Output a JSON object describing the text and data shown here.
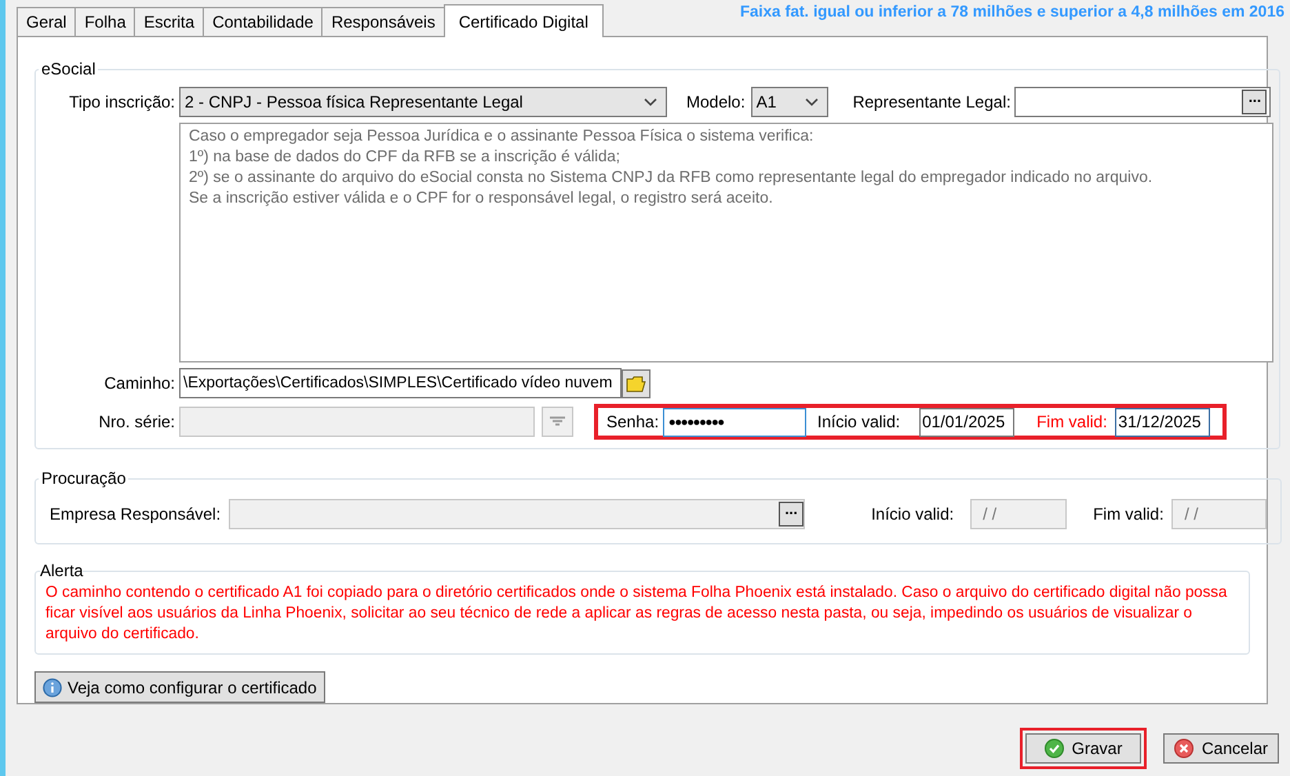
{
  "tabs": [
    {
      "label": "Geral",
      "selected": false
    },
    {
      "label": "Folha",
      "selected": false
    },
    {
      "label": "Escrita",
      "selected": false
    },
    {
      "label": "Contabilidade",
      "selected": false
    },
    {
      "label": "Responsáveis",
      "selected": false
    },
    {
      "label": "Certificado Digital",
      "selected": true
    }
  ],
  "banner": "Faixa fat. igual ou inferior a 78 milhões e superior a 4,8 milhões em 2016",
  "esocial": {
    "title": "eSocial",
    "tipo_inscricao": {
      "label": "Tipo inscrição:",
      "value": "2 - CNPJ - Pessoa física Representante Legal"
    },
    "modelo": {
      "label": "Modelo:",
      "value": "A1"
    },
    "representante_legal": {
      "label": "Representante Legal:",
      "button": "..."
    },
    "info_lines": [
      "Caso o empregador seja Pessoa Jurídica e o assinante Pessoa Física o sistema verifica:",
      "1º) na base de dados do CPF da RFB se a inscrição é válida;",
      "2º) se o assinante do arquivo do eSocial consta no Sistema CNPJ da RFB como representante legal do empregador indicado no arquivo.",
      "Se a inscrição estiver válida e o CPF for o responsável legal, o registro será aceito."
    ],
    "caminho": {
      "label": "Caminho:",
      "value": "\\Exportações\\Certificados\\SIMPLES\\Certificado vídeo nuvem"
    },
    "nro_serie": {
      "label": "Nro. série:"
    },
    "credentials": {
      "highlighted": true,
      "senha": {
        "label": "Senha:",
        "value": "●●●●●●●●●"
      },
      "inicio": {
        "label": "Início valid:",
        "value": "01/01/2025"
      },
      "fim": {
        "label": "Fim valid:",
        "value": "31/12/2025",
        "required": true
      }
    }
  },
  "procuracao": {
    "title": "Procuração",
    "empresa": {
      "label": "Empresa Responsável:",
      "button": "..."
    },
    "inicio": {
      "label": "Início valid:",
      "placeholder": "/ /"
    },
    "fim": {
      "label": "Fim valid:",
      "placeholder": "/ /"
    }
  },
  "alerta": {
    "title": "Alerta",
    "text": "O caminho contendo o certificado A1 foi copiado para o diretório certificados onde o sistema Folha Phoenix está instalado. Caso o arquivo do certificado digital não possa ficar visível aos usuários da Linha Phoenix, solicitar ao seu técnico de rede a aplicar as regras de acesso nesta pasta, ou seja, impedindo os usuários de visualizar o arquivo do certificado."
  },
  "help_button": {
    "label": "Veja como configurar o certificado"
  },
  "buttons": [
    {
      "label": "Gravar",
      "kind": "save",
      "highlighted": true
    },
    {
      "label": "Cancelar",
      "kind": "cancel",
      "highlighted": false
    }
  ]
}
